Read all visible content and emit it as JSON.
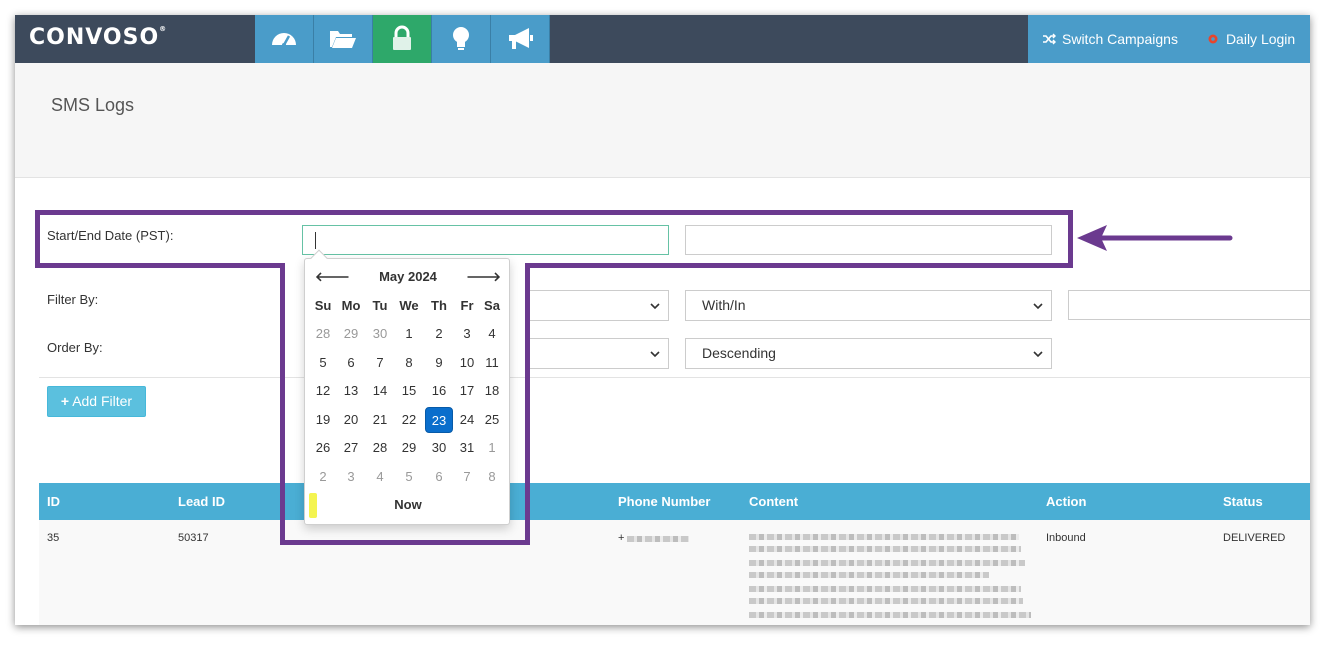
{
  "app": {
    "logo": "CONVOSO",
    "logo_mark": "®",
    "nav_icons": [
      "dashboard-icon",
      "folder-icon",
      "lock-icon",
      "lightbulb-icon",
      "megaphone-icon"
    ],
    "switch_campaigns": "Switch Campaigns",
    "daily_login": "Daily Login"
  },
  "page": {
    "title": "SMS Logs"
  },
  "form": {
    "date_label": "Start/End Date (PST):",
    "filter_label": "Filter By:",
    "order_label": "Order By:",
    "filter_operator": "With/In",
    "order_direction": "Descending",
    "add_filter": "Add Filter"
  },
  "datepicker": {
    "month": "May 2024",
    "prev": "🡐",
    "next": "🡒",
    "dow": [
      "Su",
      "Mo",
      "Tu",
      "We",
      "Th",
      "Fr",
      "Sa"
    ],
    "weeks": [
      [
        [
          "28",
          true
        ],
        [
          "29",
          true
        ],
        [
          "30",
          true
        ],
        [
          "1",
          false
        ],
        [
          "2",
          false
        ],
        [
          "3",
          false
        ],
        [
          "4",
          false
        ]
      ],
      [
        [
          "5",
          false
        ],
        [
          "6",
          false
        ],
        [
          "7",
          false
        ],
        [
          "8",
          false
        ],
        [
          "9",
          false
        ],
        [
          "10",
          false
        ],
        [
          "11",
          false
        ]
      ],
      [
        [
          "12",
          false
        ],
        [
          "13",
          false
        ],
        [
          "14",
          false
        ],
        [
          "15",
          false
        ],
        [
          "16",
          false
        ],
        [
          "17",
          false
        ],
        [
          "18",
          false
        ]
      ],
      [
        [
          "19",
          false
        ],
        [
          "20",
          false
        ],
        [
          "21",
          false
        ],
        [
          "22",
          false
        ],
        [
          "23",
          false
        ],
        [
          "24",
          false
        ],
        [
          "25",
          false
        ]
      ],
      [
        [
          "26",
          false
        ],
        [
          "27",
          false
        ],
        [
          "28",
          false
        ],
        [
          "29",
          false
        ],
        [
          "30",
          false
        ],
        [
          "31",
          false
        ],
        [
          "1",
          true
        ]
      ],
      [
        [
          "2",
          true
        ],
        [
          "3",
          true
        ],
        [
          "4",
          true
        ],
        [
          "5",
          true
        ],
        [
          "6",
          true
        ],
        [
          "7",
          true
        ],
        [
          "8",
          true
        ]
      ]
    ],
    "selected": "23",
    "now": "Now"
  },
  "table": {
    "headers": [
      "ID",
      "Lead ID",
      "Phone Number",
      "Content",
      "Action",
      "Status"
    ],
    "row": {
      "id": "35",
      "lead_id": "50317",
      "phone_prefix": "+",
      "action": "Inbound",
      "status": "DELIVERED"
    }
  },
  "colors": {
    "topbar": "#3d4a5c",
    "nav_blue": "#4a9cc9",
    "nav_active": "#2ea86a",
    "table_head": "#4aaed4",
    "highlight": "#6b3a8f",
    "selected_day": "#0a6ecc"
  }
}
